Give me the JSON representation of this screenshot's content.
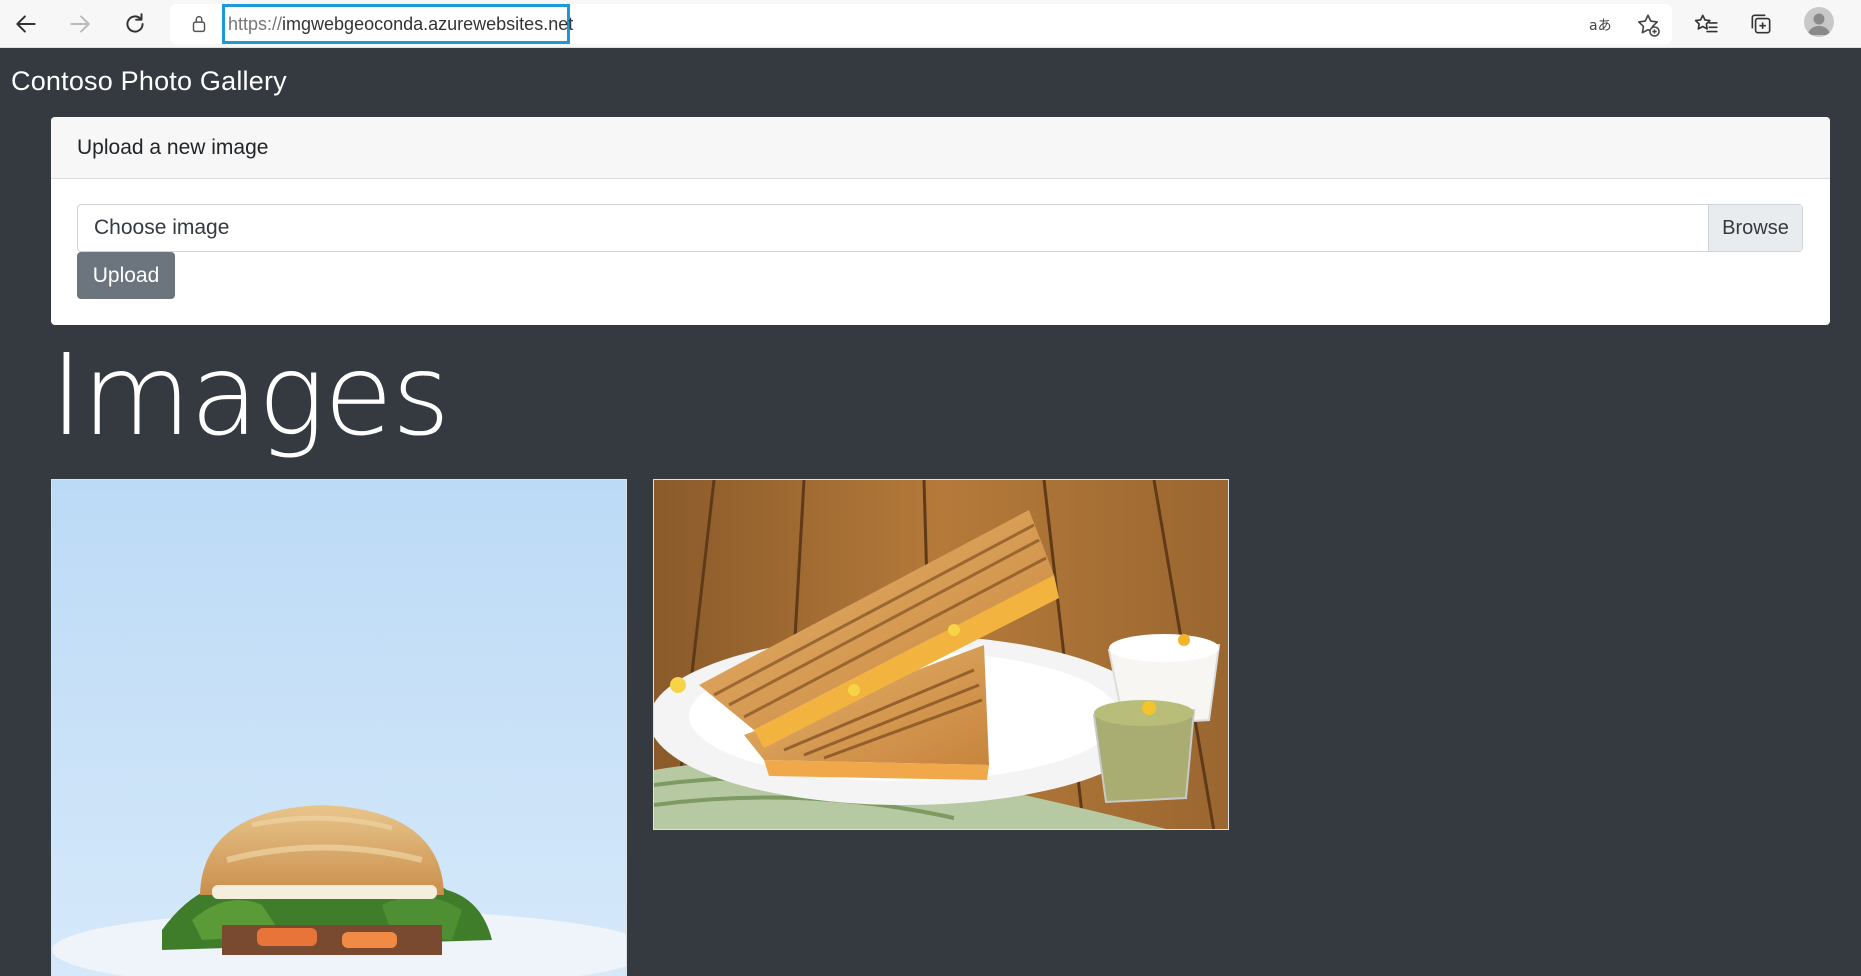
{
  "browser": {
    "url_scheme": "https://",
    "url_host": "imgwebgeoconda.azurewebsites.net",
    "icons": [
      "back-icon",
      "forward-icon",
      "refresh-icon",
      "lock-icon",
      "read-aloud-icon",
      "add-favorite-icon",
      "favorites-icon",
      "collections-icon",
      "profile-icon"
    ]
  },
  "page": {
    "brand": "Contoso Photo Gallery",
    "upload_card": {
      "header": "Upload a new image",
      "file_label": "Choose image",
      "browse_label": "Browse",
      "upload_label": "Upload"
    },
    "images_heading": "Images",
    "images": [
      {
        "name": "sandwich-on-blue-background"
      },
      {
        "name": "grilled-sandwich-on-plate"
      }
    ]
  },
  "colors": {
    "page_background": "#343a40",
    "url_highlight": "#1b9ad6",
    "upload_button": "#6c757d"
  }
}
